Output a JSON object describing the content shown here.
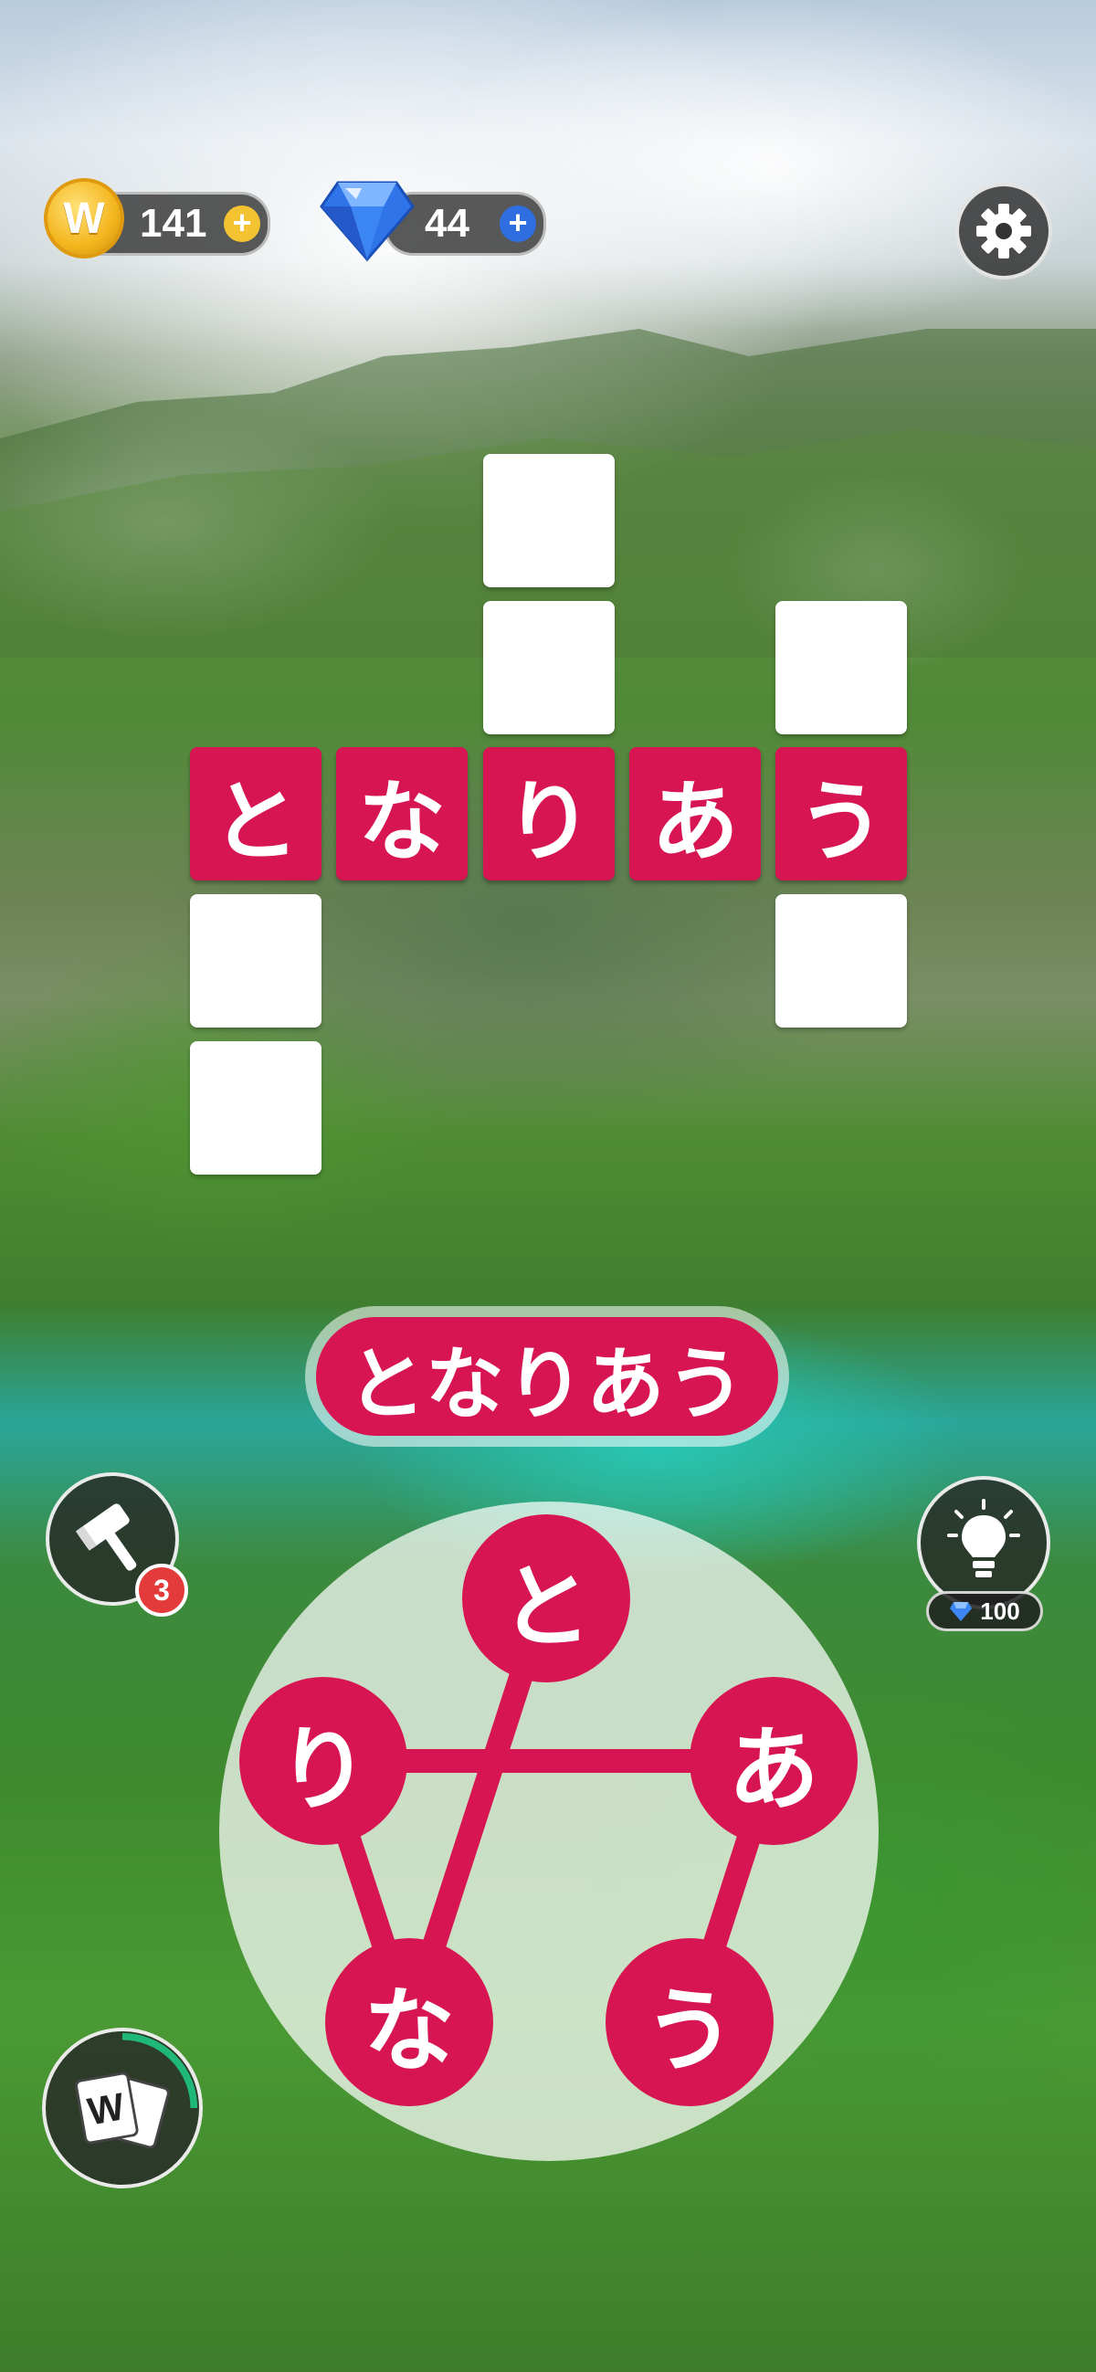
{
  "currency": {
    "coins": "141",
    "coin_symbol": "W",
    "gems": "44",
    "plus": "+"
  },
  "grid": {
    "across_word": [
      "と",
      "な",
      "り",
      "あ",
      "う"
    ]
  },
  "current_word": "となりあう",
  "tools": {
    "hammer_count": "3",
    "hint_cost": "100",
    "word_card_letter": "W"
  },
  "wheel": {
    "letters": [
      "と",
      "り",
      "あ",
      "な",
      "う"
    ]
  },
  "colors": {
    "accent": "#d81553",
    "tile_empty": "#ffffff"
  },
  "icons": [
    "coin-icon",
    "gem-icon",
    "gear-icon",
    "hammer-icon",
    "lightbulb-icon",
    "word-cards-icon"
  ]
}
